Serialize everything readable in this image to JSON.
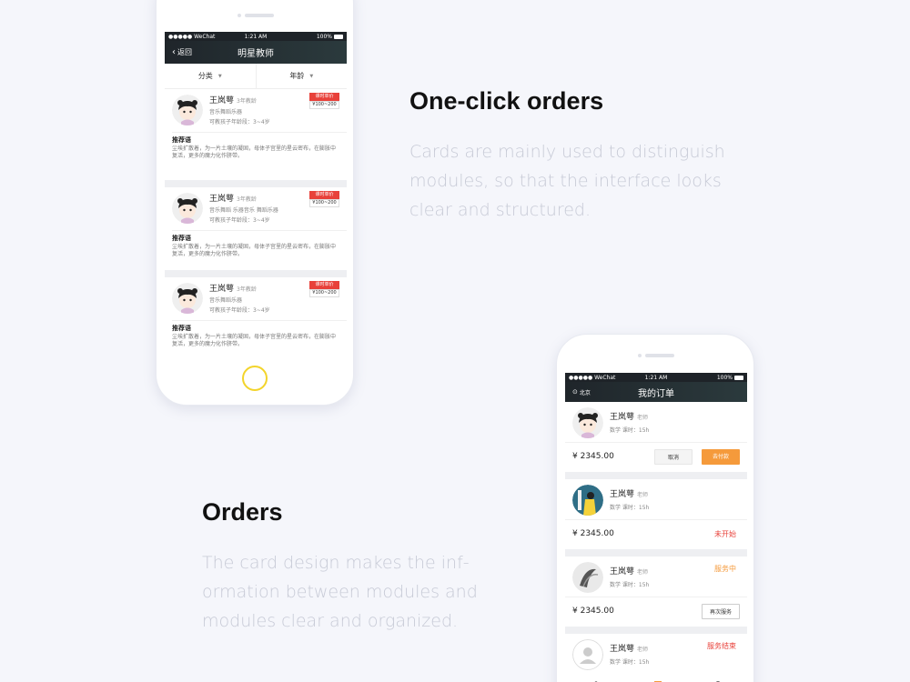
{
  "section1": {
    "title": "One-click orders",
    "description": "Cards are mainly used to distinguish modules, so that the interface looks clear and structured."
  },
  "section2": {
    "title": "Orders",
    "description": "The card design makes the inf-ormation between modules and modules clear and organized."
  },
  "phone1": {
    "status": {
      "carrier": "●●●●● WeChat",
      "time": "1:21 AM",
      "battery": "100%"
    },
    "nav": {
      "back": "返回",
      "title": "明星教师"
    },
    "filters": [
      "分类",
      "年龄"
    ],
    "teachers": [
      {
        "name": "王岚萼",
        "years": "3年教龄",
        "subjects": "音乐舞蹈乐器",
        "ages": "可教孩子年龄段：3~4岁",
        "price_label": "课时单价",
        "price": "¥100~200",
        "rec_title": "推荐语",
        "rec": "尘埃扩散着，为一片土壤的凝固，母体子宫里的星云密布，在膨胀中复活，更多的魔力化作脐带。"
      },
      {
        "name": "王岚萼",
        "years": "3年教龄",
        "subjects": "音乐舞蹈 乐器音乐 舞蹈乐器",
        "ages": "可教孩子年龄段：3~4岁",
        "price_label": "课时单价",
        "price": "¥100~200",
        "rec_title": "推荐语",
        "rec": "尘埃扩散着，为一片土壤的凝固，母体子宫里的星云密布，在膨胀中复活，更多的魔力化作脐带。"
      },
      {
        "name": "王岚萼",
        "years": "3年教龄",
        "subjects": "音乐舞蹈乐器",
        "ages": "可教孩子年龄段：3~4岁",
        "price_label": "课时单价",
        "price": "¥100~200",
        "rec_title": "推荐语",
        "rec": "尘埃扩散着，为一片土壤的凝固，母体子宫里的星云密布，在膨胀中复活，更多的魔力化作脐带。"
      }
    ]
  },
  "phone2": {
    "status": {
      "carrier": "●●●●● WeChat",
      "time": "1:21 AM",
      "battery": "100%"
    },
    "nav": {
      "location": "北京",
      "title": "我的订单"
    },
    "orders": [
      {
        "name": "王岚萼",
        "role": "老师",
        "meta": "数学   课时：15h",
        "amount": "¥ 2345.00",
        "status": "",
        "cancel": "取消",
        "pay": "去付款"
      },
      {
        "name": "王岚萼",
        "role": "老师",
        "meta": "数学   课时：15h",
        "amount": "¥ 2345.00",
        "status": "未开始"
      },
      {
        "name": "王岚萼",
        "role": "老师",
        "meta": "数学   课时：15h",
        "amount": "¥ 2345.00",
        "status": "服务中",
        "again": "再次服务"
      },
      {
        "name": "王岚萼",
        "role": "老师",
        "meta": "数学   课时：15h",
        "status": "服务结束"
      }
    ]
  },
  "colors": {
    "accent_red": "#e8413a",
    "accent_orange": "#f59a3b",
    "nav_dark": "#1f252a"
  }
}
